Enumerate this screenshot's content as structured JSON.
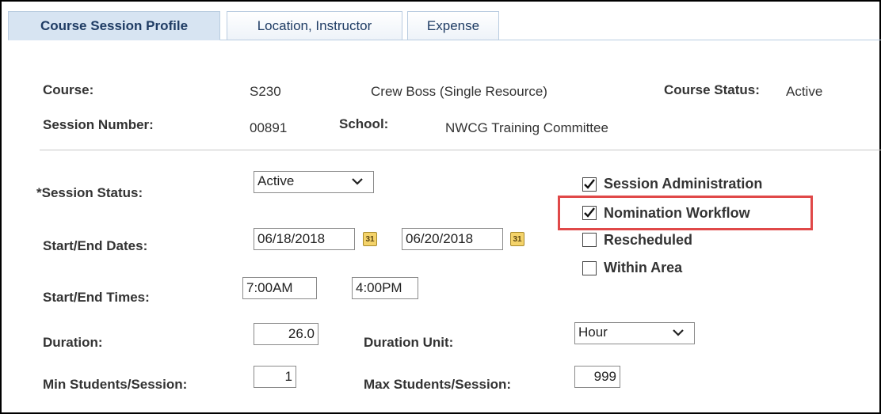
{
  "tabs": [
    {
      "label": "Course Session Profile",
      "active": true
    },
    {
      "label": "Location, Instructor",
      "active": false
    },
    {
      "label": "Expense",
      "active": false
    }
  ],
  "header": {
    "course_label": "Course:",
    "course_code": "S230",
    "course_title": "Crew Boss (Single Resource)",
    "course_status_label": "Course Status:",
    "course_status_value": "Active",
    "session_number_label": "Session Number:",
    "session_number_value": "00891",
    "school_label": "School:",
    "school_value": "NWCG Training Committee"
  },
  "form": {
    "session_status_label": "*Session Status:",
    "session_status_value": "Active",
    "start_end_dates_label": "Start/End Dates:",
    "start_date": "06/18/2018",
    "end_date": "06/20/2018",
    "calendar_glyph": "31",
    "start_end_times_label": "Start/End Times:",
    "start_time": "7:00AM",
    "end_time": "4:00PM",
    "duration_label": "Duration:",
    "duration_value": "26.0",
    "duration_unit_label": "Duration Unit:",
    "duration_unit_value": "Hour",
    "min_students_label": "Min Students/Session:",
    "min_students_value": "1",
    "max_students_label": "Max Students/Session:",
    "max_students_value": "999"
  },
  "checkboxes": [
    {
      "label": "Session Administration",
      "checked": true
    },
    {
      "label": "Nomination Workflow",
      "checked": true,
      "highlighted": true
    },
    {
      "label": "Rescheduled",
      "checked": false
    },
    {
      "label": "Within Area",
      "checked": false
    }
  ],
  "colors": {
    "highlight_border": "#e04848",
    "active_tab_bg": "#d7e4f2",
    "tab_text": "#1f3c64"
  }
}
